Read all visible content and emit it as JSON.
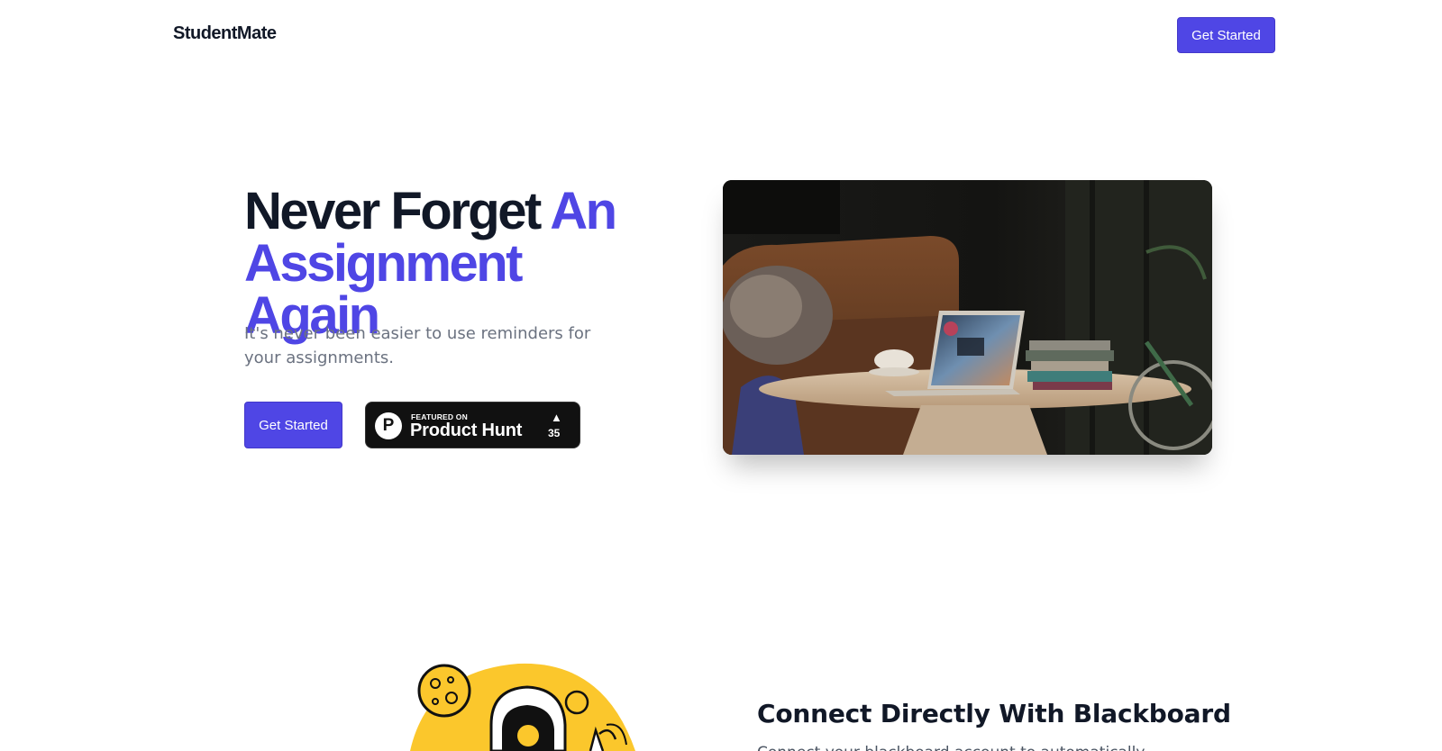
{
  "header": {
    "brand": "StudentMate",
    "cta_label": "Get Started"
  },
  "hero": {
    "title_dark": "Never Forget ",
    "title_accent": "An Assignment Again",
    "subtitle": "It's never been easier to use reminders for your assignments.",
    "cta_label": "Get Started",
    "image_icon": "laptop-photo"
  },
  "product_hunt": {
    "logo_letter": "P",
    "featured_label": "FEATURED ON",
    "name": "Product Hunt",
    "upvote_symbol": "▲",
    "count": "35"
  },
  "feature": {
    "title": "Connect Directly With Blackboard",
    "description": "Connect your blackboard account to automatically",
    "illustration_icon": "astronaut-illustration"
  },
  "colors": {
    "accent": "#4f46e5",
    "heading": "#111827",
    "muted": "#6b7280",
    "illustration_yellow": "#fbc72c"
  }
}
